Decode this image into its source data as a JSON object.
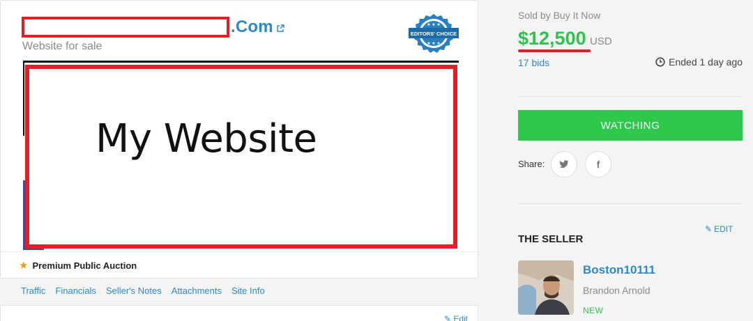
{
  "listing": {
    "domain_suffix": ".Com",
    "subtitle": "Website for sale",
    "badge_text": "EDITORS' CHOICE",
    "preview_text": "My Website",
    "auction_type": "Premium Public Auction"
  },
  "tabs": [
    {
      "label": "Traffic"
    },
    {
      "label": "Financials"
    },
    {
      "label": "Seller's Notes"
    },
    {
      "label": "Attachments"
    },
    {
      "label": "Site Info"
    }
  ],
  "lower": {
    "edit_label": "Edit"
  },
  "sidebar": {
    "sold_by": "Sold by Buy It Now",
    "price": "$12,500",
    "currency": "USD",
    "bids": "17 bids",
    "ended": "Ended 1 day ago",
    "watch_label": "WATCHING",
    "share_label": "Share:",
    "share_buttons": [
      {
        "icon": "twitter-icon"
      },
      {
        "icon": "facebook-icon"
      }
    ],
    "edit_label": "EDIT",
    "seller_heading": "THE SELLER",
    "seller_username": "Boston10111",
    "seller_name": "Brandon Arnold",
    "seller_status": "NEW"
  },
  "colors": {
    "accent_blue": "#2a8ac9",
    "price_green": "#2ec34b",
    "watch_green": "#2ec84d",
    "redaction_red": "#e11f27",
    "star_gold": "#e9a100"
  }
}
